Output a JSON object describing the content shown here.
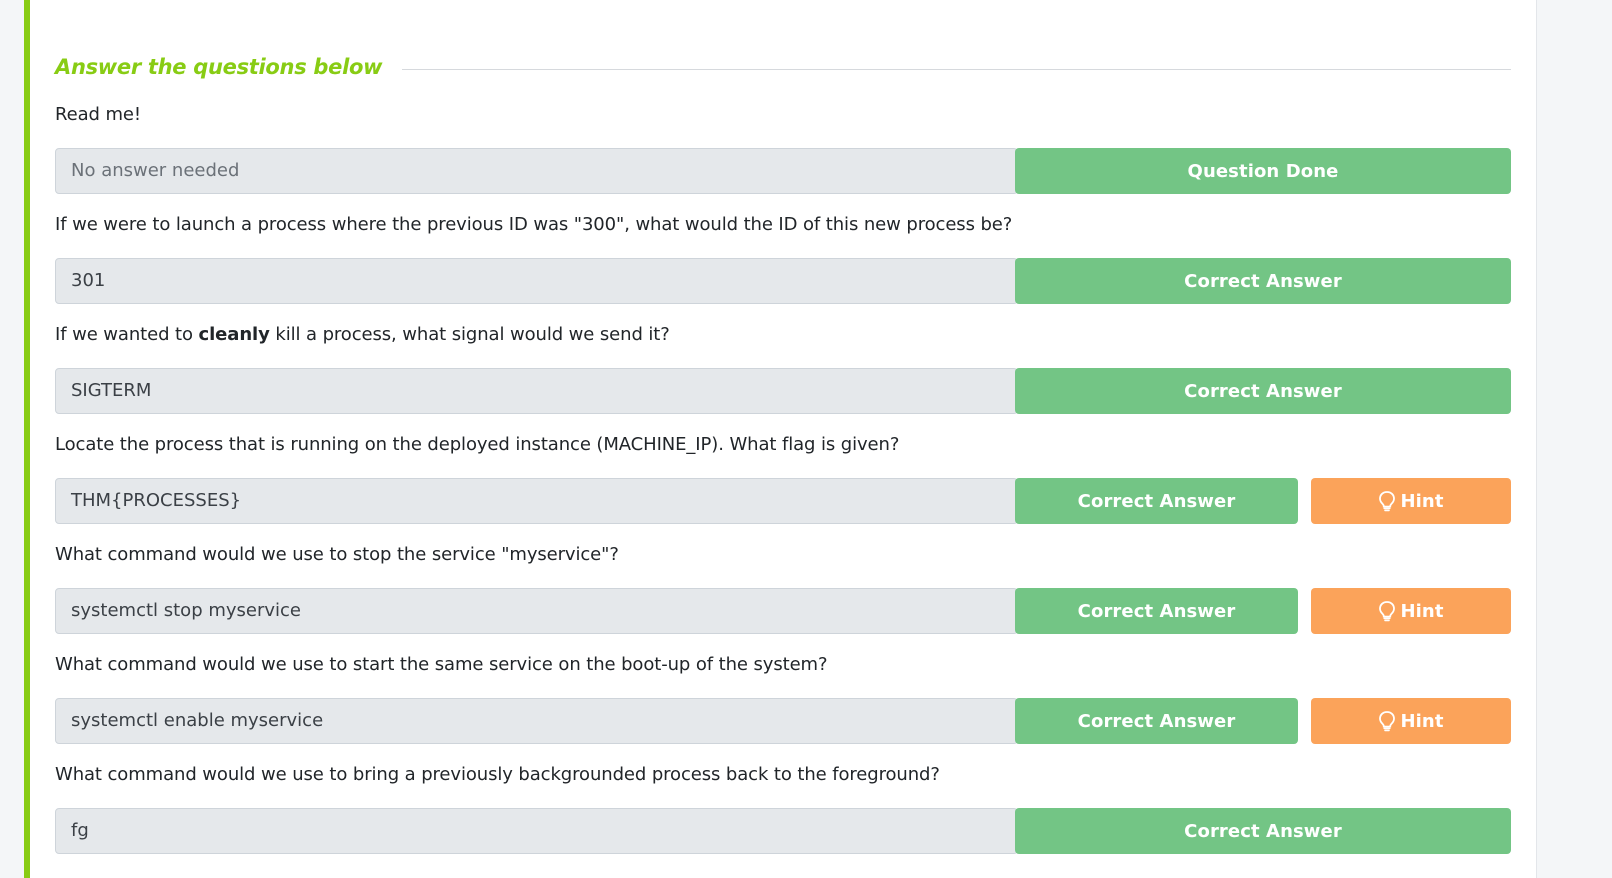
{
  "section": {
    "title": "Answer the questions below"
  },
  "questions": [
    {
      "prefix": "Read me!",
      "bold": "",
      "suffix": "",
      "answer": "No answer needed",
      "answer_is_placeholder": true,
      "button": "Question Done",
      "hint": ""
    },
    {
      "prefix": "If we were to launch a process where the previous ID was \"300\", what would the ID of this new process be?",
      "bold": "",
      "suffix": "",
      "answer": "301",
      "answer_is_placeholder": false,
      "button": "Correct Answer",
      "hint": ""
    },
    {
      "prefix": "If we wanted to ",
      "bold": "cleanly",
      "suffix": " kill a process, what signal would we send it?",
      "answer": "SIGTERM",
      "answer_is_placeholder": false,
      "button": "Correct Answer",
      "hint": ""
    },
    {
      "prefix": "Locate the process that is running on the deployed instance (MACHINE_IP). What flag is given?",
      "bold": "",
      "suffix": "",
      "answer": "THM{PROCESSES}",
      "answer_is_placeholder": false,
      "button": "Correct Answer",
      "hint": "Hint"
    },
    {
      "prefix": "What command would we use to stop the service \"myservice\"?",
      "bold": "",
      "suffix": "",
      "answer": "systemctl stop myservice",
      "answer_is_placeholder": false,
      "button": "Correct Answer",
      "hint": "Hint"
    },
    {
      "prefix": "What command would we use to start the same service on the boot-up of the system?",
      "bold": "",
      "suffix": "",
      "answer": "systemctl enable myservice",
      "answer_is_placeholder": false,
      "button": "Correct Answer",
      "hint": "Hint"
    },
    {
      "prefix": "What command would we use to bring a previously backgrounded process back to the foreground?",
      "bold": "",
      "suffix": "",
      "answer": "fg",
      "answer_is_placeholder": false,
      "button": "Correct Answer",
      "hint": ""
    }
  ],
  "colors": {
    "accent": "#88cc14",
    "success_button": "#73c585",
    "hint_button": "#fba35a",
    "answer_field": "#e5e8eb"
  },
  "icons": {
    "hint": "lightbulb-icon"
  }
}
